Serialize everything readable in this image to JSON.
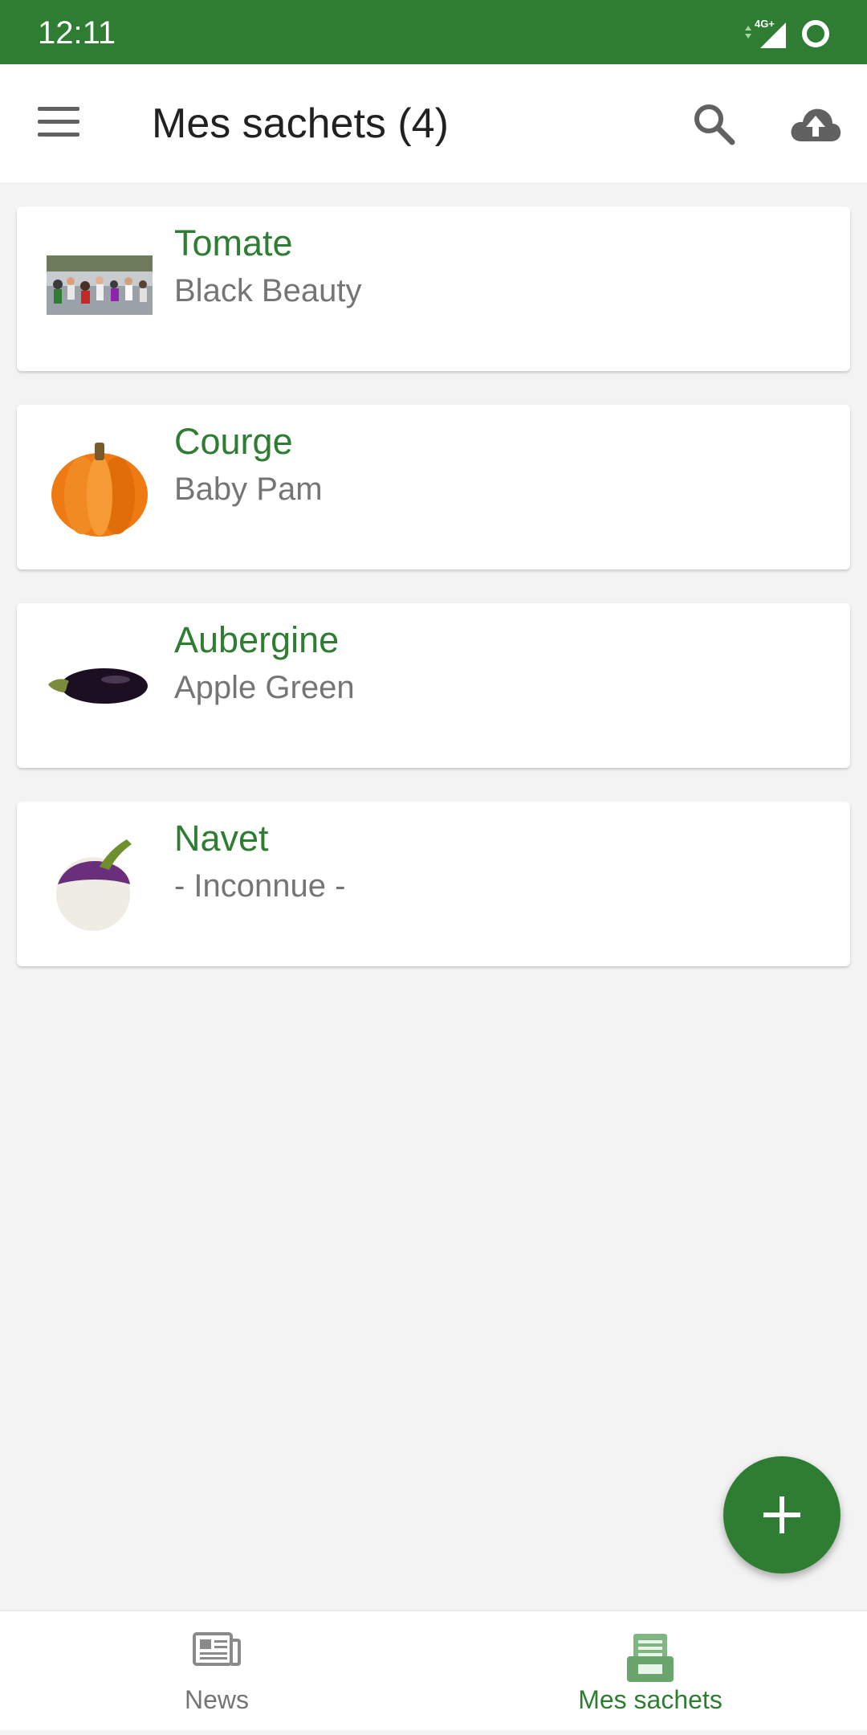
{
  "status_bar": {
    "time": "12:11",
    "network": "4G+"
  },
  "app_bar": {
    "title": "Mes sachets (4)",
    "menu_icon": "hamburger-menu-icon",
    "search_icon": "search-icon",
    "upload_icon": "cloud-upload-icon"
  },
  "cards": [
    {
      "name": "Tomate",
      "variety": "Black Beauty",
      "image": "photo-thumbnail"
    },
    {
      "name": "Courge",
      "variety": "Baby Pam",
      "image": "pumpkin"
    },
    {
      "name": "Aubergine",
      "variety": "Apple Green",
      "image": "eggplant"
    },
    {
      "name": "Navet",
      "variety": "- Inconnue -",
      "image": "turnip"
    }
  ],
  "fab": {
    "icon": "plus-icon"
  },
  "bottom_nav": {
    "items": [
      {
        "label": "News",
        "icon": "newspaper-icon",
        "active": false
      },
      {
        "label": "Mes sachets",
        "icon": "seed-packet-icon",
        "active": true
      }
    ]
  },
  "colors": {
    "primary": "#2e7d32",
    "background": "#f3f3f3",
    "secondary_text": "#757575"
  }
}
